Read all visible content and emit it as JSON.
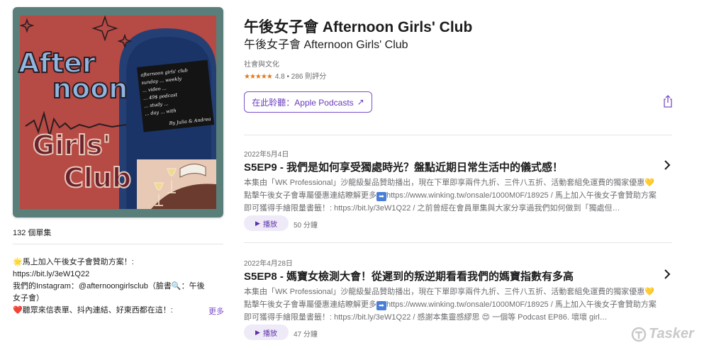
{
  "artwork": {
    "title_line1": "After",
    "title_line2": "noon",
    "title_line3": "Girls'",
    "title_line4": "Club",
    "note_title": "afternoon girls' club",
    "note_lines": [
      "sunday ... weekly",
      "... video ...",
      "... 49$ podcast",
      "... study ...",
      "... day ... with"
    ],
    "note_signature": "By Julia & Andrea"
  },
  "sidebar": {
    "episode_count": "132 個單集",
    "description_lines": [
      "🌟馬上加入午後女子會贊助方案！:",
      "https://bit.ly/3eW1Q22",
      "我們的Instagram：@afternoongirlsclub（臉書🔍：午後",
      "女子會）",
      "❤️聽眾來信表單、抖內連結、好東西都在這！:"
    ],
    "more_label": "更多"
  },
  "header": {
    "title": "午後女子會 Afternoon Girls' Club",
    "author": "午後女子會 Afternoon Girls' Club",
    "category": "社會與文化",
    "stars": "★★★★★",
    "rating_text": "4.8 • 286 則評分",
    "listen_label": "在此聆聽：Apple Podcasts",
    "listen_arrow": "↗"
  },
  "episodes": [
    {
      "date": "2022年5月4日",
      "title": "S5EP9 - 我們是如何享受獨處時光？盤點近期日常生活中的儀式感！",
      "summary_a": "本集由「WK Professional」沙龍級髮品贊助播出，現在下單即享兩件九折、三件八五折、活動套組免運費的獨家優惠",
      "summary_b": " 點擊午後女子會專屬優惠連結瞭解更多",
      "summary_c": "https://www.winking.tw/onsale/1000M0F/18925 / 馬上加入午後女子會贊助方案即可獲得手繪限量書籤！: https://bit.ly/3eW1Q22 / 之前曾經在會員單集與大家分享過我們如何做到「獨處但…",
      "play_label": "播放",
      "duration": "50 分鐘"
    },
    {
      "date": "2022年4月28日",
      "title": "S5EP8 - 媽寶女檢測大會！從遲到的叛逆期看看我們的媽寶指數有多高",
      "summary_a": "本集由「WK Professional」沙龍級髮品贊助播出，現在下單即享兩件九折、三件八五折、活動套組免運費的獨家優惠",
      "summary_b": " 點擊午後女子會專屬優惠連結瞭解更多",
      "summary_c": "https://www.winking.tw/onsale/1000M0F/18925 / 馬上加入午後女子會贊助方案即可獲得手繪限量書籤！: https://bit.ly/3eW1Q22 / 感謝本集靈感繆思 😍 一個等 Podcast EP86. 壞壞 girl…",
      "play_label": "播放",
      "duration": "47 分鐘"
    }
  ],
  "watermark": {
    "text": "Tasker"
  },
  "colors": {
    "accent": "#7d4fc9",
    "star": "#e07a1f",
    "art_background": "#b64a44",
    "art_title_fill": "#8fb6e0",
    "art_club_fill": "#6b2230",
    "art_panel": "#1e3f7a"
  }
}
